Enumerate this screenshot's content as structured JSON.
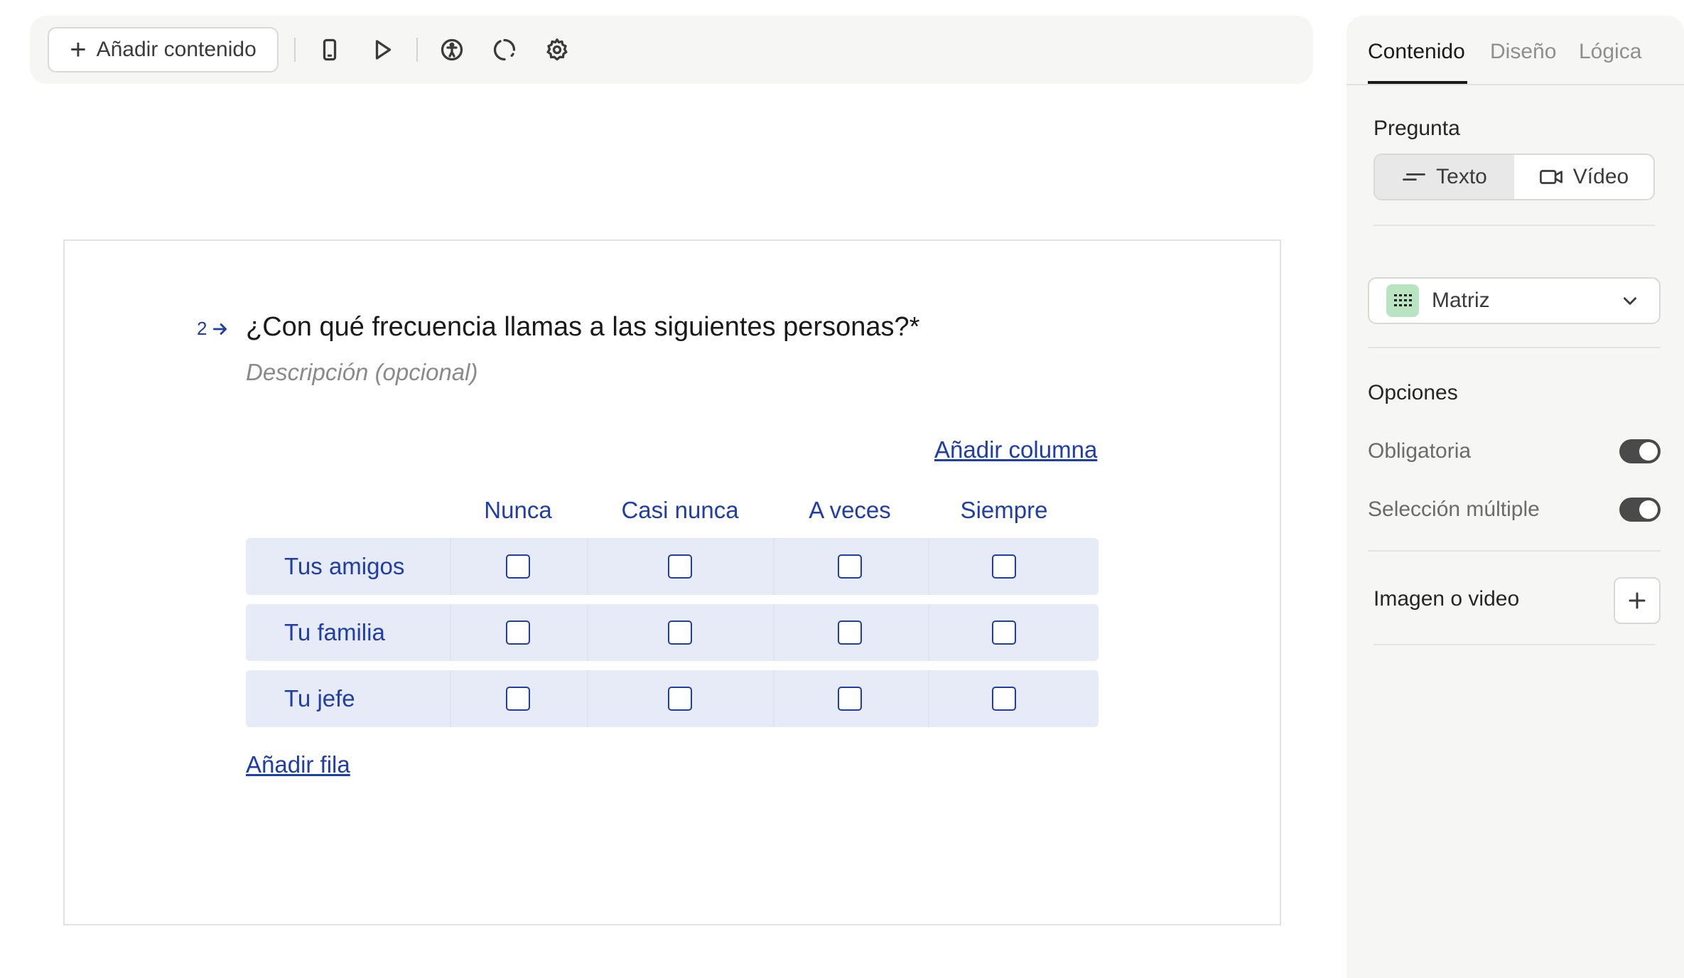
{
  "toolbar": {
    "add_content_label": "Añadir contenido",
    "icons": [
      "mobile-preview-icon",
      "play-icon",
      "accessibility-icon",
      "loading-icon",
      "settings-icon"
    ]
  },
  "question": {
    "number": "2",
    "title": "¿Con qué frecuencia llamas a las siguientes personas?*",
    "description_placeholder": "Descripción (opcional)",
    "add_column_label": "Añadir columna",
    "add_row_label": "Añadir fila",
    "columns": [
      "Nunca",
      "Casi nunca",
      "A veces",
      "Siempre"
    ],
    "rows": [
      "Tus amigos",
      "Tu familia",
      "Tu jefe"
    ]
  },
  "panel": {
    "tabs": [
      "Contenido",
      "Diseño",
      "Lógica"
    ],
    "active_tab": "Contenido",
    "question_label": "Pregunta",
    "format_options": [
      "Texto",
      "Vídeo"
    ],
    "active_format": "Texto",
    "type_value": "Matriz",
    "options_label": "Opciones",
    "required_label": "Obligatoria",
    "required_on": true,
    "multi_select_label": "Selección múltiple",
    "multi_select_on": true,
    "media_label": "Imagen o video"
  },
  "colors": {
    "accent": "#1f3ea8",
    "row_bg": "#e7ebf7",
    "type_badge": "#b9e4c2",
    "panel_bg": "#f6f6f5"
  }
}
